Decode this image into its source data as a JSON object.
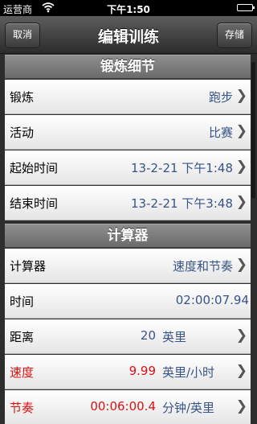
{
  "status_bar": {
    "carrier": "运营商",
    "time": "下午1:50"
  },
  "nav": {
    "title": "编辑训练",
    "cancel_label": "取消",
    "save_label": "存储"
  },
  "sections": {
    "details": {
      "title": "锻炼细节",
      "rows": [
        {
          "label": "锻炼",
          "value": "跑步"
        },
        {
          "label": "活动",
          "value": "比赛"
        },
        {
          "label": "起始时间",
          "value": "13-2-21 下午1:48"
        },
        {
          "label": "结束时间",
          "value": "13-2-21 下午3:48"
        }
      ]
    },
    "calculator": {
      "title": "计算器",
      "calculator_row": {
        "label": "计算器",
        "value": "速度和节奏"
      },
      "time_row": {
        "label": "时间",
        "value": "02:00:07.94"
      },
      "distance_row": {
        "label": "距离",
        "number": "20",
        "unit": "英里"
      },
      "speed_row": {
        "label": "速度",
        "number": "9.99",
        "unit": "英里/小时"
      },
      "pace_row": {
        "label": "节奏",
        "number": "00:06:00.4",
        "unit": "分钟/英里"
      }
    }
  },
  "colors": {
    "value_blue": "#385487",
    "highlight_red": "#e01010"
  },
  "icons": [
    "wifi-icon",
    "battery-icon",
    "chevron-right-icon"
  ]
}
